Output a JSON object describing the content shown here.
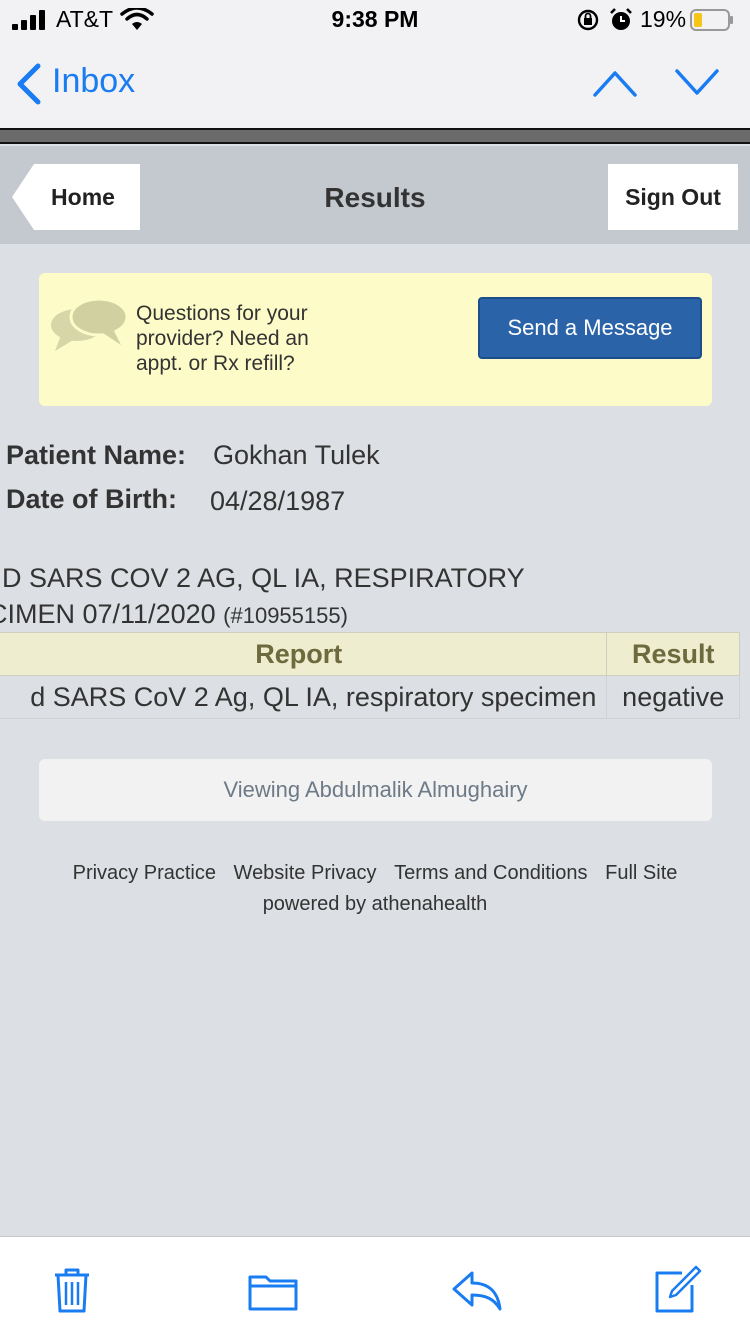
{
  "status_bar": {
    "carrier": "AT&T",
    "time": "9:38 PM",
    "battery": "19%"
  },
  "nav": {
    "back_label": "Inbox"
  },
  "header": {
    "home": "Home",
    "title": "Results",
    "sign_out": "Sign Out"
  },
  "banner": {
    "text": "Questions for your provider? Need an appt. or Rx refill?",
    "button": "Send a Message"
  },
  "patient": {
    "name_label": "Patient Name:",
    "name": "Gokhan Tulek",
    "dob_label": "Date of Birth:",
    "dob": "04/28/1987"
  },
  "test": {
    "line1": "D SARS COV 2 AG, QL IA, RESPIRATORY",
    "line2": "CIMEN 07/11/2020",
    "id": "(#10955155)"
  },
  "table": {
    "headers": [
      "Report",
      "Result"
    ],
    "rows": [
      [
        "d SARS CoV 2 Ag, QL IA, respiratory specimen",
        "negative"
      ]
    ]
  },
  "viewing": "Viewing Abdulmalik Almughairy",
  "footer": {
    "links": [
      "Privacy Practice",
      "Website Privacy",
      "Terms and Conditions",
      "Full Site"
    ],
    "powered": "powered by athenahealth"
  },
  "colors": {
    "ios_blue": "#1a7cf2",
    "send_button": "#2b63a9",
    "banner_bg": "#fdfcc9",
    "table_header_bg": "#eeedd0"
  }
}
